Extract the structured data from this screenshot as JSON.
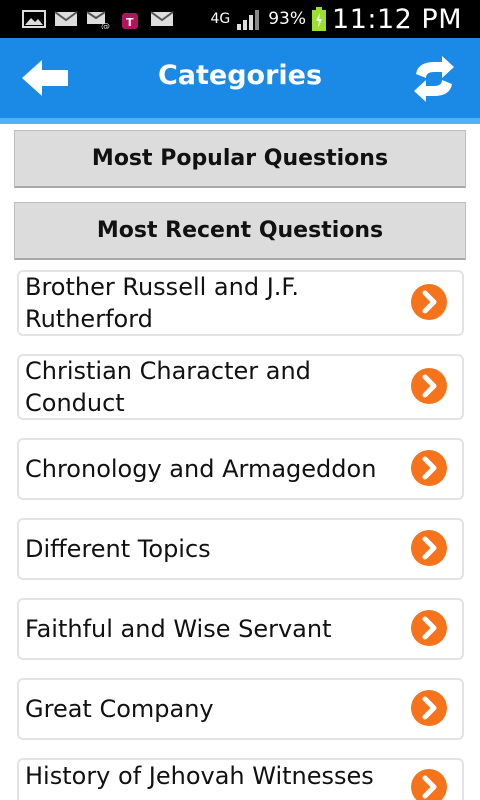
{
  "status_bar": {
    "network": "4G",
    "battery": "93%",
    "time": "11:12 PM",
    "icons": [
      "image-icon",
      "mail-icon",
      "mail-at-icon",
      "tmobile-bag-icon",
      "mail-icon",
      "signal-icon",
      "battery-charging-icon"
    ]
  },
  "header": {
    "title": "Categories",
    "back_icon": "arrow-left-icon",
    "refresh_icon": "refresh-icon",
    "color": "#1a8ae6"
  },
  "buttons": {
    "popular": "Most Popular Questions",
    "recent": "Most Recent Questions"
  },
  "categories": [
    "Brother Russell and J.F. Rutherford",
    "Christian Character and Conduct",
    "Chronology and Armageddon",
    "Different Topics",
    "Faithful and Wise Servant",
    "Great Company",
    "History of Jehovah Witnesses"
  ],
  "accent": "#f5731b"
}
